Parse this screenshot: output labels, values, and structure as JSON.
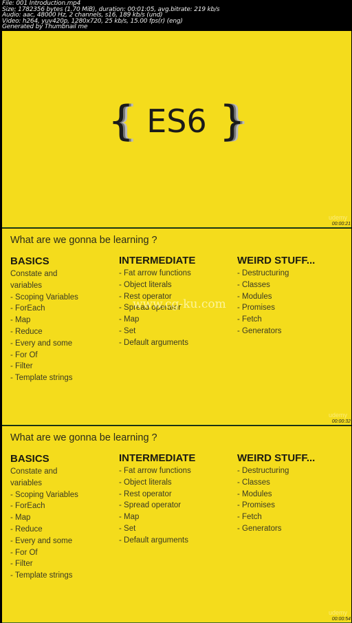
{
  "info": {
    "lines": [
      "File: 001 Introduction.mp4",
      "Size: 1782356 bytes (1.70 MiB), duration: 00:01:05, avg.bitrate: 219 kb/s",
      "Audio: aac, 48000 Hz, 2 channels, s16, 189 kb/s (und)",
      "Video: h264, yuv420p, 1280x720, 25 kb/s, 15.00 fps(r) (eng)",
      "Generated by Thumbnail me"
    ]
  },
  "colors": {
    "slide_background": "#f4dc1c",
    "text": "#2a2a1a"
  },
  "frames": [
    {
      "logo": {
        "left_brace": "{",
        "text": "ES6",
        "right_brace": "}"
      },
      "brand": "udemy",
      "timestamp": "00:00:21"
    },
    {
      "title": "What are we gonna be learning ?",
      "watermark": "www.cg-ku.com",
      "brand": "udemy",
      "timestamp": "00:00:32"
    },
    {
      "title": "What are we gonna be learning ?",
      "brand": "udemy",
      "timestamp": "00:00:54"
    }
  ],
  "columns": [
    {
      "heading": "BASICS",
      "items": [
        " Constate and",
        "variables",
        "- Scoping Variables",
        "- ForEach",
        "- Map",
        "- Reduce",
        "- Every and some",
        "- For Of",
        "- Filter",
        "- Template strings"
      ]
    },
    {
      "heading": "INTERMEDIATE",
      "items": [
        "- Fat arrow functions",
        "- Object literals",
        "- Rest operator",
        "- Spread operator",
        "- Map",
        "- Set",
        "- Default arguments"
      ]
    },
    {
      "heading": "WEIRD STUFF...",
      "items": [
        "- Destructuring",
        "- Classes",
        "- Modules",
        "- Promises",
        "- Fetch",
        "- Generators"
      ]
    }
  ]
}
